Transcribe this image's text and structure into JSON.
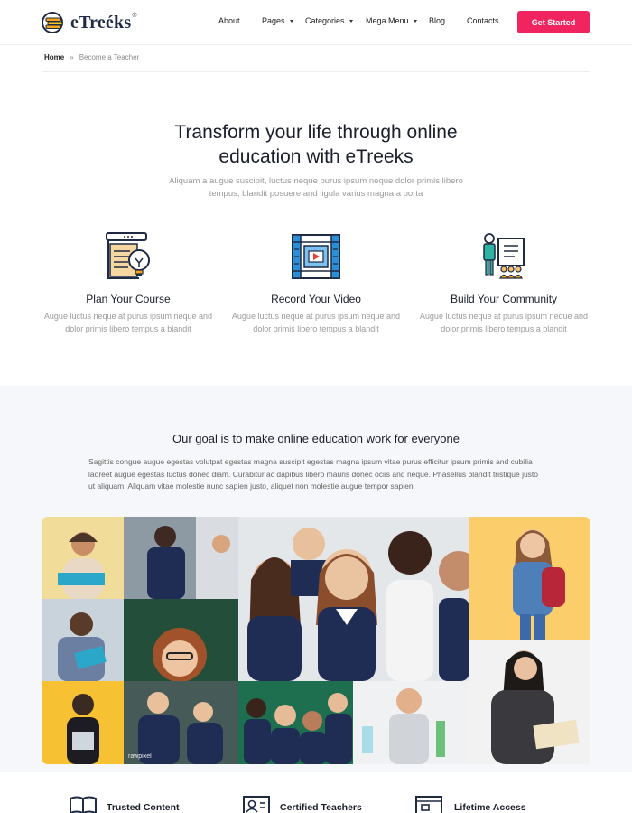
{
  "brand": {
    "name": "eTreéks",
    "mark": "®"
  },
  "nav": {
    "items": [
      {
        "label": "About",
        "dropdown": false
      },
      {
        "label": "Pages",
        "dropdown": true
      },
      {
        "label": "Categories",
        "dropdown": true
      },
      {
        "label": "Mega Menu",
        "dropdown": true
      },
      {
        "label": "Blog",
        "dropdown": false
      },
      {
        "label": "Contacts",
        "dropdown": false
      }
    ],
    "cta_label": "Get Started"
  },
  "breadcrumb": {
    "home": "Home",
    "separator": "»",
    "current": "Become a Teacher"
  },
  "hero": {
    "title": "Transform your life through online education with eTreeks",
    "subtitle": "Aliquam a augue suscipit, luctus neque purus ipsum neque dolor primis libero tempus, blandit posuere and ligula varius magna a porta"
  },
  "features": [
    {
      "icon": "plan-course-icon",
      "title": "Plan Your Course",
      "desc": "Augue luctus neque at purus ipsum neque and dolor primis libero tempus a blandit"
    },
    {
      "icon": "record-video-icon",
      "title": "Record Your Video",
      "desc": "Augue luctus neque at purus ipsum neque and dolor primis libero tempus a blandit"
    },
    {
      "icon": "build-community-icon",
      "title": "Build Your Community",
      "desc": "Augue luctus neque at purus ipsum neque and dolor primis libero tempus a blandit"
    }
  ],
  "goal": {
    "title": "Our goal is to make online education work for everyone",
    "text": "Sagittis congue augue egestas volutpat egestas magna suscipit egestas magna ipsum vitae purus efficitur ipsum primis and cubilia laoreet augue egestas luctus donec diam. Curabitur ac dapibus libero mauris donec ociis and neque. Phasellus blandit tristique justo ut aliquam. Aliquam vitae molestie nunc sapien justo, aliquet non molestie augue tempor sapien",
    "watermark": "rawpixel"
  },
  "bottom_features": [
    {
      "icon": "book-icon",
      "label": "Trusted Content"
    },
    {
      "icon": "certificate-icon",
      "label": "Certified Teachers"
    },
    {
      "icon": "lifetime-icon",
      "label": "Lifetime Access"
    }
  ],
  "colors": {
    "accent": "#f0245f",
    "text_dark": "#1b1f2b",
    "muted": "#9a9a9a",
    "section_bg": "#f6f7fa",
    "icon_blue": "#2d8ed8",
    "icon_orange": "#f6a21e"
  }
}
